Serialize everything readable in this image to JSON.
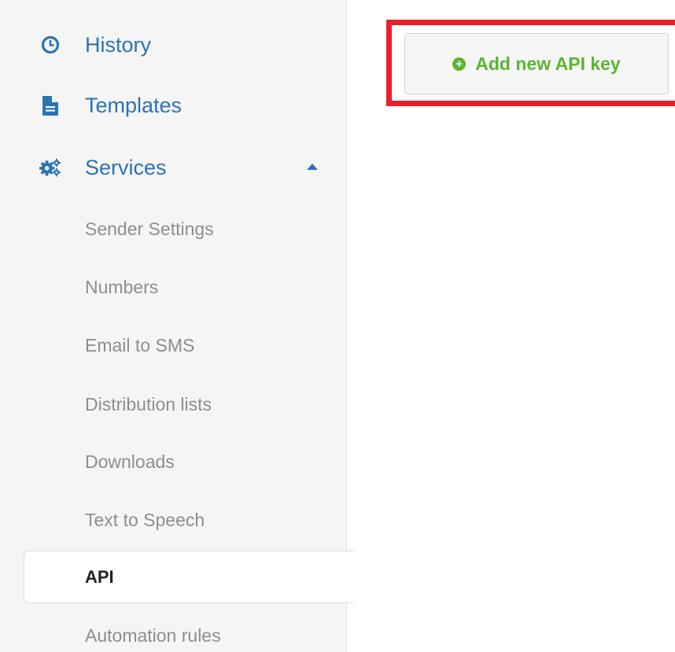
{
  "sidebar": {
    "history_label": "History",
    "templates_label": "Templates",
    "services_label": "Services",
    "services_expanded": true,
    "sub_items": [
      "Sender Settings",
      "Numbers",
      "Email to SMS",
      "Distribution lists",
      "Downloads",
      "Text to Speech",
      "API",
      "Automation rules"
    ],
    "active_item": "API"
  },
  "main": {
    "add_button_label": "Add new API key"
  },
  "colors": {
    "link_blue": "#2b74b3",
    "sub_item_gray": "#8e8e8e",
    "add_green": "#5db431",
    "highlight_red": "#e8202a"
  },
  "icons": {
    "history": "clock-icon",
    "templates": "file-icon",
    "services": "gears-icon",
    "services_toggle": "caret-up-icon",
    "add": "plus-circle-icon"
  }
}
